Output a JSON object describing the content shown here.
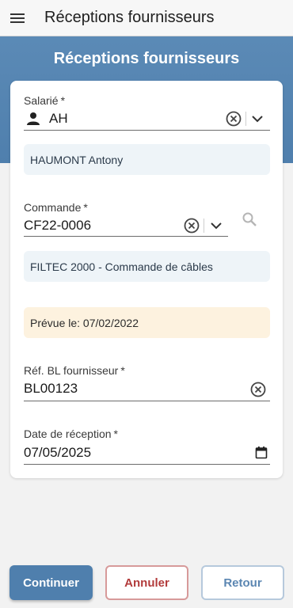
{
  "topbar": {
    "title": "Réceptions fournisseurs",
    "menu_icon": "hamburger-menu-icon"
  },
  "banner": {
    "title": "Réceptions fournisseurs"
  },
  "form": {
    "salarie": {
      "label": "Salarié",
      "required": "*",
      "value": "AH",
      "icon": "person-icon"
    },
    "salarie_info": "HAUMONT Antony",
    "commande": {
      "label": "Commande",
      "required": "*",
      "value": "CF22-0006"
    },
    "commande_info": "FILTEC 2000 - Commande de câbles",
    "prevue": "Prévue le: 07/02/2022",
    "ref_bl": {
      "label": "Réf. BL fournisseur",
      "required": "*",
      "value": "BL00123"
    },
    "date_reception": {
      "label": "Date de réception",
      "required": "*",
      "value": "07/05/2025"
    }
  },
  "actions": {
    "continue": "Continuer",
    "cancel": "Annuler",
    "back": "Retour"
  },
  "colors": {
    "primary": "#4f7fad",
    "danger": "#b23b3b",
    "warning_bg": "#fdf2df",
    "info_bg": "#eef4f8"
  }
}
